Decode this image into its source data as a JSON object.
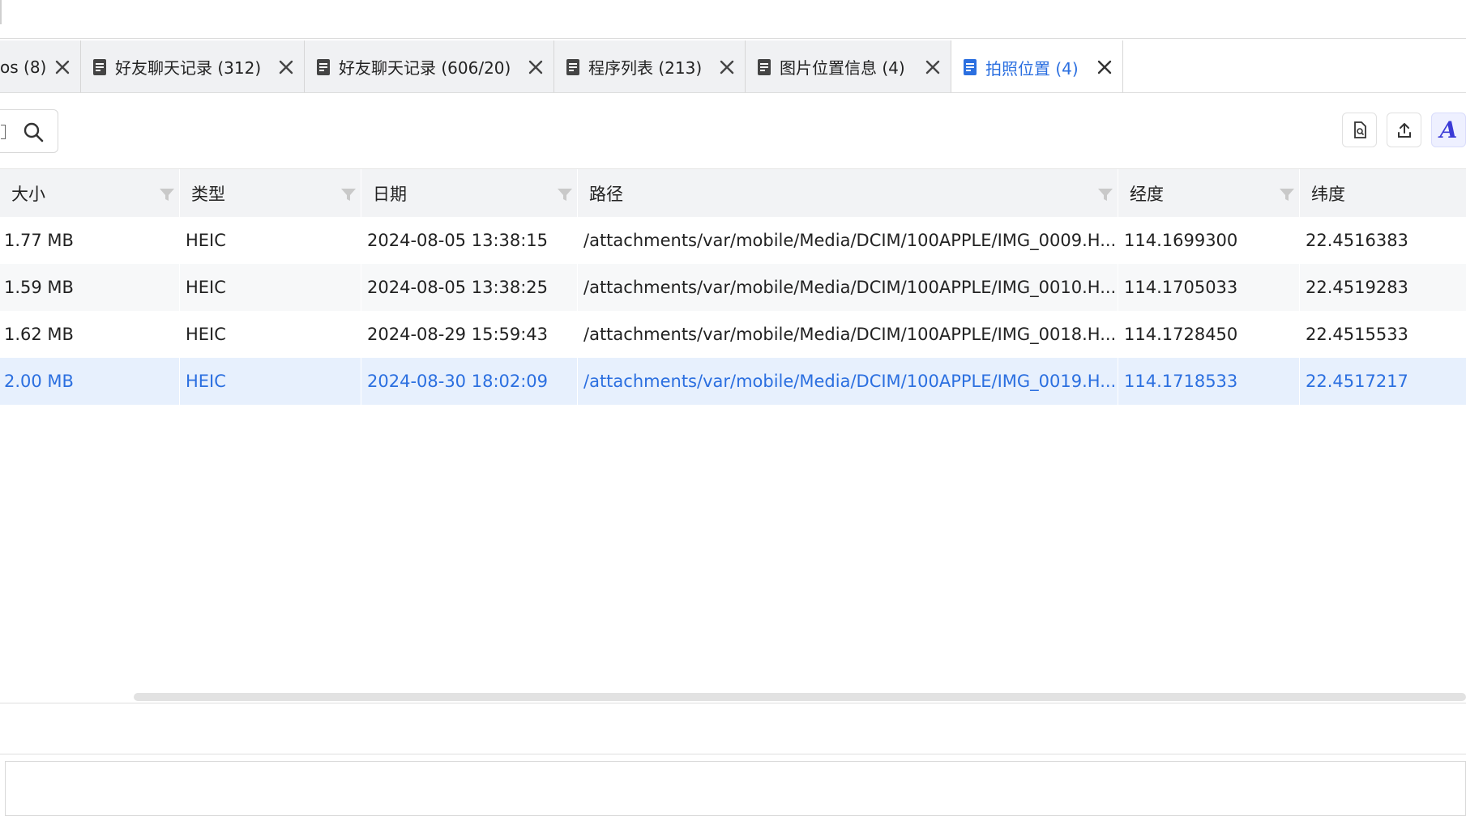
{
  "tabs": [
    {
      "label": "os (8)"
    },
    {
      "label": "好友聊天记录 (312)"
    },
    {
      "label": "好友聊天记录 (606/20)"
    },
    {
      "label": "程序列表 (213)"
    },
    {
      "label": "图片位置信息 (4)"
    },
    {
      "label": "拍照位置 (4)"
    }
  ],
  "icons": {
    "tab_icon": "document-icon",
    "tab_close": "close-icon",
    "search": "search-icon",
    "filter": "filter-icon",
    "toolbar": [
      "file-preview-icon",
      "upload-icon",
      "ai-assistant-icon"
    ]
  },
  "toolbar": {
    "ai_glyph": "A"
  },
  "colors": {
    "accent": "#2b6fe0",
    "selected_row": "#e7f0fd",
    "header_bg": "#f2f3f5",
    "ai_accent": "#3b3bd6"
  },
  "table": {
    "columns": [
      "大小",
      "类型",
      "日期",
      "路径",
      "经度",
      "纬度"
    ],
    "rows": [
      [
        "1.77 MB",
        "HEIC",
        "2024-08-05 13:38:15",
        "/attachments/var/mobile/Media/DCIM/100APPLE/IMG_0009.H...",
        "114.1699300",
        "22.4516383"
      ],
      [
        "1.59 MB",
        "HEIC",
        "2024-08-05 13:38:25",
        "/attachments/var/mobile/Media/DCIM/100APPLE/IMG_0010.H...",
        "114.1705033",
        "22.4519283"
      ],
      [
        "1.62 MB",
        "HEIC",
        "2024-08-29 15:59:43",
        "/attachments/var/mobile/Media/DCIM/100APPLE/IMG_0018.H...",
        "114.1728450",
        "22.4515533"
      ],
      [
        "2.00 MB",
        "HEIC",
        "2024-08-30 18:02:09",
        "/attachments/var/mobile/Media/DCIM/100APPLE/IMG_0019.H...",
        "114.1718533",
        "22.4517217"
      ]
    ],
    "selected_row": 3
  }
}
